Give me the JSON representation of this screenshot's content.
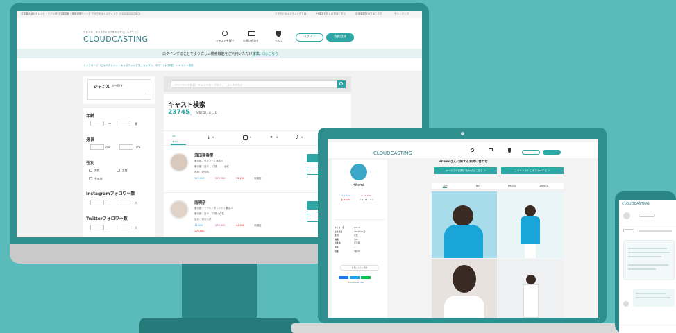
{
  "desktop": {
    "topbar_left": "日本最大級のタレント・モデル等【仕事依頼・撮影依頼サイト】クラウドキャスティング（CLOUDCASTING）",
    "topbar_links": [
      "クラウドキャスティングとは",
      "仕事をお探しの方はこちら",
      "出演事務所の方はこちら",
      "サイトマップ"
    ],
    "logo_sub": "タレント・キャスティングをカンタン、スマートに",
    "logo": "CLOUDCASTING",
    "nav": [
      "キャストを探す",
      "お問い合わせ",
      "ヘルプ"
    ],
    "login": "ログイン",
    "register": "会員登録",
    "notice": "ログインすることでより詳しい検索機能をご利用いただけます。",
    "notice_link": "詳しくはこちら",
    "breadcrumb": "トップページ（ビルのタレント・キャスティングを、カンタン、スマートに実現）＞ キャスト検索",
    "search_placeholder": "フリーワード検索：キャスト名・プロフィール・タグなど",
    "genre_title": "ジャンル",
    "genre_sub": "から探す",
    "filters": {
      "age": "年齢",
      "age_unit": "歳",
      "height": "身長",
      "height_unit": "cm",
      "gender": "性別",
      "male": "男性",
      "female": "女性",
      "other": "その他",
      "instagram": "Instagramフォロワー数",
      "twitter": "Twitterフォロワー数",
      "tilde": "〜",
      "k": "人"
    },
    "result_title": "キャスト検索",
    "result_count": "23745",
    "result_unit": "人",
    "result_suffix": "が該当しました",
    "tab_all": "すべて",
    "tab_counts": [
      "0",
      "0",
      "0",
      "0",
      "0"
    ],
    "casts": [
      {
        "name": "須田亜香里",
        "role": "東京都 / タレント / 著名人",
        "meta": "東京都　日本　32歳　—　女性",
        "agency": "出身：愛知県",
        "stats": [
          "187,000",
          "270,000",
          "12,100",
          "未設定"
        ]
      },
      {
        "name": "南明奈",
        "role": "東京都 / モデル / タレント / 著名人",
        "meta": "東京都　日本　32歳 / 女性",
        "agency": "出身：神奈川県",
        "stats": [
          "14,000",
          "270,000",
          "41,200",
          "未設定",
          "100,000"
        ]
      }
    ],
    "cast_btn1": "仕事",
    "cast_btn2": "お気に"
  },
  "laptop": {
    "inquiry_title": "Hitomiさんに関するお問い合わせ",
    "btn_mail": "メールでのお問い合わせはこちら ＞",
    "btn_offer": "このキャストにオファーする ＞",
    "profile_name": "Hitomi",
    "tabs": [
      "TOP",
      "BIO",
      "PHOTO",
      "LIMITED"
    ],
    "info_rows": [
      [
        "キャスト名",
        "Hitomi"
      ],
      [
        "生年月日",
        "1999年12月"
      ],
      [
        "性別",
        "女性"
      ],
      [
        "国籍",
        "日本"
      ],
      [
        "出身地",
        "東京都"
      ],
      [
        "身長",
        "—"
      ],
      [
        "所属",
        "(株)XX"
      ]
    ],
    "favorite": "お気に入りに登録",
    "powered": "CLOUDCASTING"
  },
  "phone": {
    "logo": "CLOUDCASTING"
  }
}
